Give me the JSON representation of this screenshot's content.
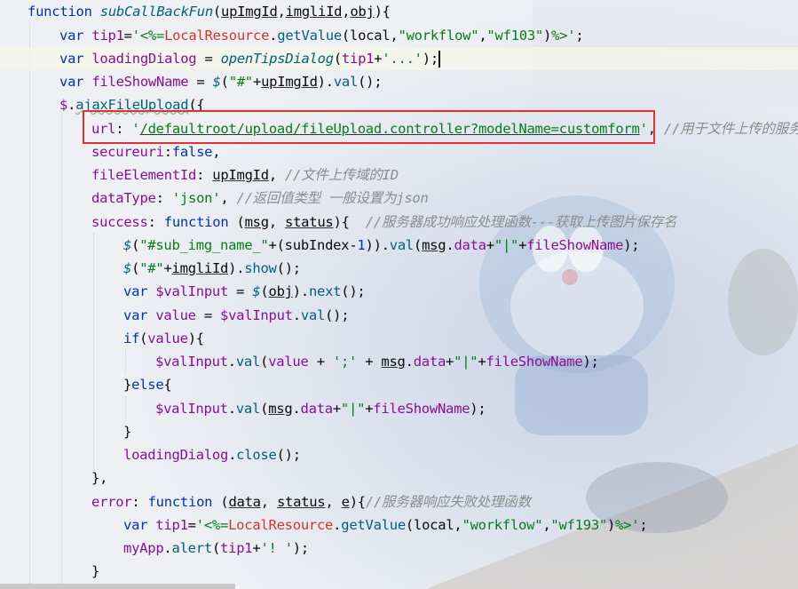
{
  "lines": [
    "function subCallBackFun(upImgId,imgliId,obj){",
    "var tip1='<%=LocalResource.getValue(local,\"workflow\",\"wf103\")%>';",
    "var loadingDialog = openTipsDialog(tip1+'...');",
    "var fileShowName = $(\"#\"+upImgId).val();",
    "$.ajaxFileUpload({",
    "url: '/defaultroot/upload/fileUpload.controller?modelName=customform', //用于文件上传的服务器",
    "secureuri:false,",
    "fileElementId: upImgId, //文件上传域的ID",
    "dataType: 'json', //返回值类型 一般设置为json",
    "success: function (msg, status){  //服务器成功响应处理函数---获取上传图片保存名",
    "$(\"#sub_img_name_\"+(subIndex-1)).val(msg.data+\"|\"+fileShowName);",
    "$(\"#\"+imgliId).show();",
    "var $valInput = $(obj).next();",
    "var value = $valInput.val();",
    "if(value){",
    "$valInput.val(value + ';' + msg.data+\"|\"+fileShowName);",
    "}else{",
    "$valInput.val(msg.data+\"|\"+fileShowName);",
    "}",
    "loadingDialog.close();",
    "},",
    "error: function (data, status, e){//服务器响应失败处理函数",
    "var tip1='<%=LocalResource.getValue(local,\"workflow\",\"wf193\")%>';",
    "myApp.alert(tip1+'! ');",
    "}"
  ],
  "editor": {
    "current_line": 3,
    "highlighted_line": 6,
    "highlight_color": "#e5312c"
  }
}
